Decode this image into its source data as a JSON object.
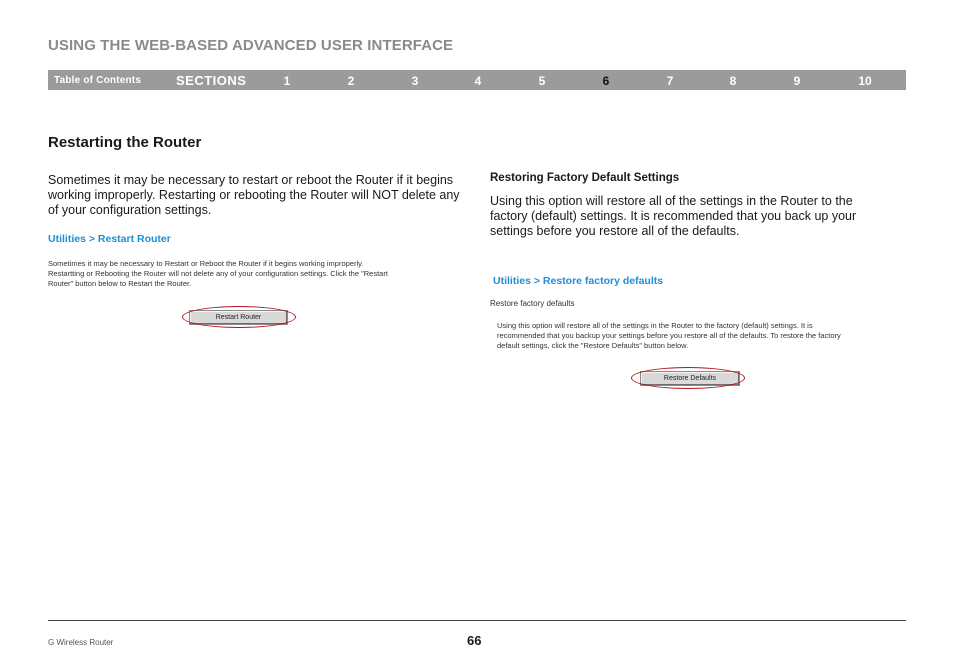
{
  "header": {
    "title": "USING THE WEB-BASED ADVANCED USER INTERFACE"
  },
  "nav": {
    "toc_label": "Table of Contents",
    "sections_label": "SECTIONS",
    "items": [
      "1",
      "2",
      "3",
      "4",
      "5",
      "6",
      "7",
      "8",
      "9",
      "10"
    ],
    "active": "6"
  },
  "section_title": "Restarting the Router",
  "left": {
    "paragraph": "Sometimes it may be necessary to restart or reboot the Router if it begins working improperly. Restarting or rebooting the Router will NOT delete any of your configuration settings.",
    "screenshot": {
      "breadcrumb": "Utilities > Restart Router",
      "line1": "Sometimes it may be necessary to Restart or Reboot the Router if it begins working improperly.",
      "line2": "Restartting or Rebooting the Router will not delete any of your configuration settings. Click the \"Restart",
      "line3": "Router\" button below to Restart the Router.",
      "button_label": "Restart Router"
    }
  },
  "right": {
    "heading": "Restoring Factory Default Settings",
    "paragraph": "Using this option will restore all of the settings in the Router to the factory (default) settings. It is recommended that you back up your settings before you restore all of the defaults.",
    "screenshot": {
      "breadcrumb": "Utilities > Restore factory defaults",
      "subtitle": "Restore factory defaults",
      "line1": "Using this option will restore all of the settings in the Router to the factory (default) settings. It is",
      "line2": "recommended that you backup your settings before you restore all of the defaults. To restore the factory",
      "line3": "default settings, click the \"Restore Defaults\" button below.",
      "button_label": "Restore Defaults"
    }
  },
  "footer": {
    "product": "G Wireless Router",
    "page_number": "66"
  },
  "colors": {
    "nav_bar": "#9b9b9b",
    "header_text": "#8a8a8a",
    "breadcrumb_blue": "#1e8fd6",
    "highlight_red": "#b3141a"
  }
}
